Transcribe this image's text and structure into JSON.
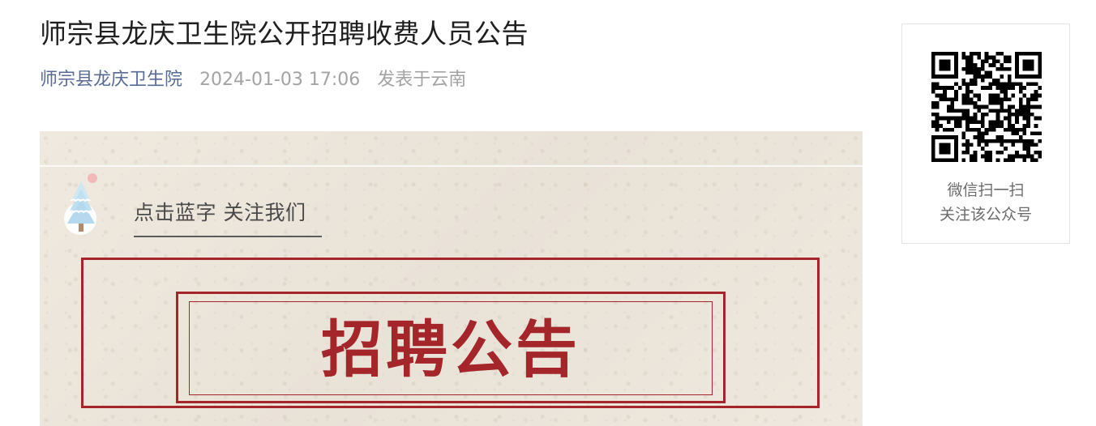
{
  "article": {
    "title": "师宗县龙庆卫生院公开招聘收费人员公告",
    "author": "师宗县龙庆卫生院",
    "date": "2024-01-03 17:06",
    "location": "发表于云南"
  },
  "content": {
    "follow_prompt": "点击蓝字 关注我们",
    "headline": "招聘公告",
    "accent_color": "#a4252a",
    "decoration_icon": "snowy-tree-icon"
  },
  "qr_card": {
    "line1": "微信扫一扫",
    "line2": "关注该公众号",
    "icon": "qr-code-icon"
  },
  "colors": {
    "link": "#576b95",
    "muted": "#a3a3a3",
    "paper_background": "#ede7dd"
  }
}
